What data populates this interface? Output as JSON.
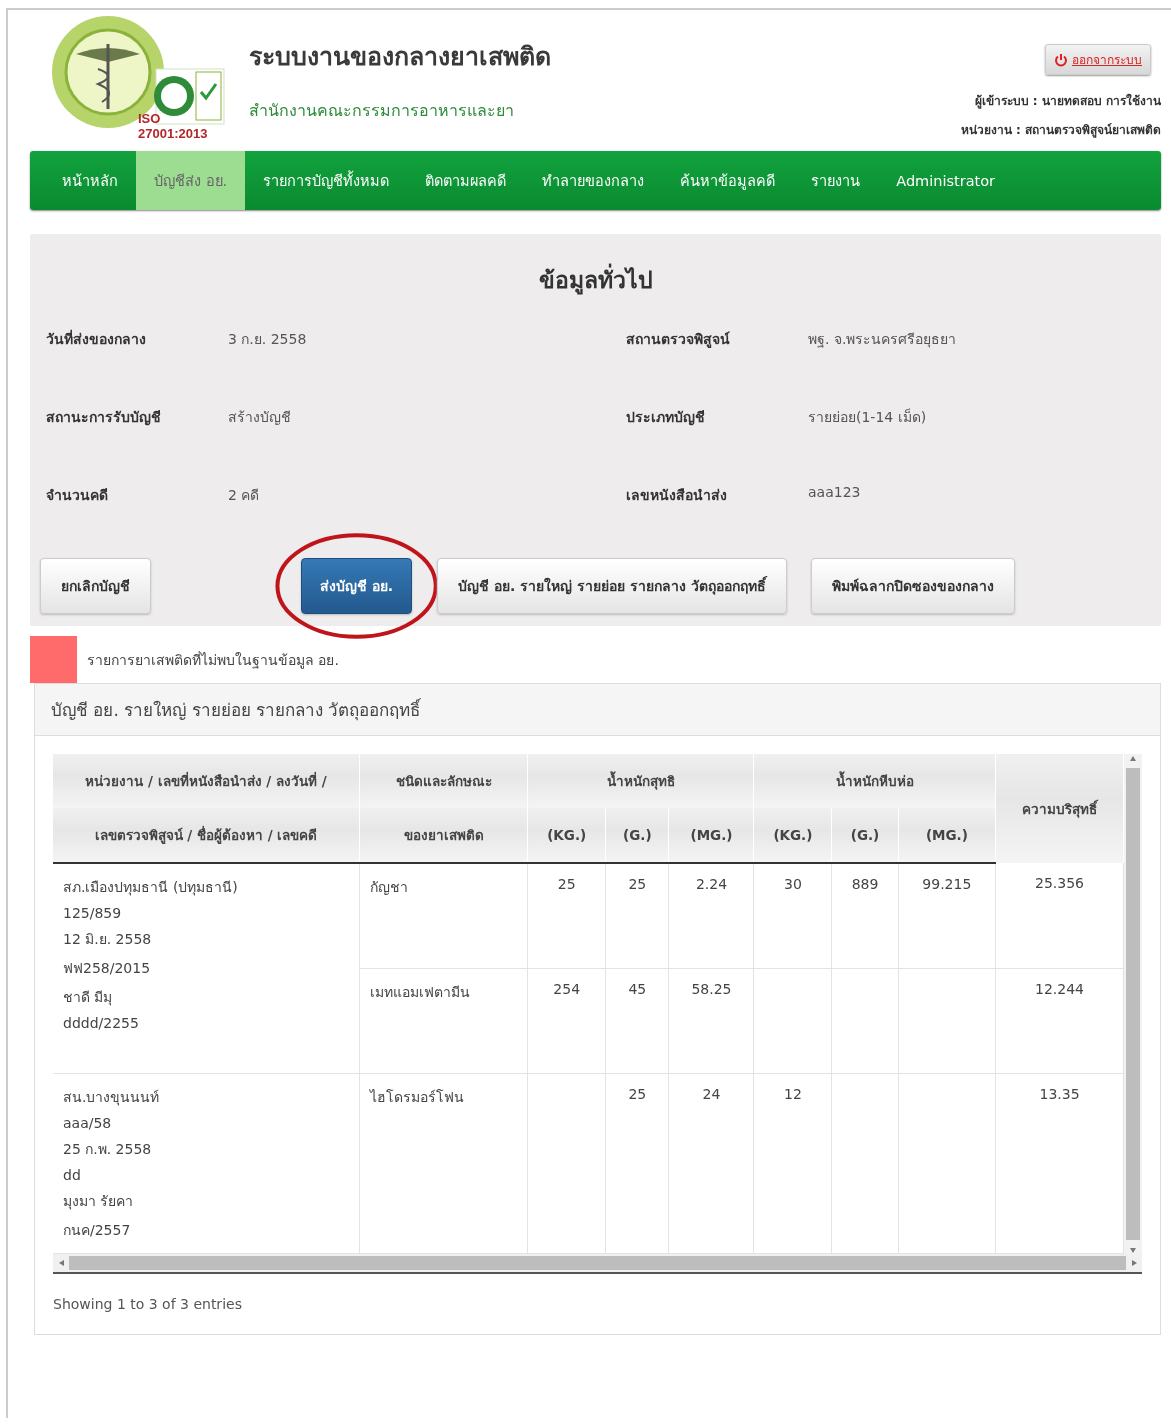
{
  "header": {
    "title": "ระบบงานของกลางยาเสพติด",
    "subtitle": "สำนักงานคณะกรรมการอาหารและยา",
    "logo_caption": "ISO 27001:2013",
    "logout": "ออกจากระบบ",
    "user_line": "ผู้เข้าระบบ : นายทดสอบ การใช้งาน",
    "unit_line": "หน่วยงาน : สถานตรวจพิสูจน์ยาเสพติด"
  },
  "nav": [
    {
      "label": "หน้าหลัก",
      "selected": false
    },
    {
      "label": "บัญชีส่ง อย.",
      "selected": true
    },
    {
      "label": "รายการบัญชีทั้งหมด",
      "selected": false
    },
    {
      "label": "ติดตามผลคดี",
      "selected": false
    },
    {
      "label": "ทำลายของกลาง",
      "selected": false
    },
    {
      "label": "ค้นหาข้อมูลคดี",
      "selected": false
    },
    {
      "label": "รายงาน",
      "selected": false
    },
    {
      "label": "Administrator",
      "selected": false
    }
  ],
  "info": {
    "title": "ข้อมูลทั่วไป",
    "fields": [
      {
        "label": "วันที่ส่งของกลาง",
        "value": "3 ก.ย. 2558"
      },
      {
        "label": "สถานตรวจพิสูจน์",
        "value": "พฐ. จ.พระนครศรีอยุธยา"
      },
      {
        "label": "สถานะการรับบัญชี",
        "value": "สร้างบัญชี"
      },
      {
        "label": "ประเภทบัญชี",
        "value": "รายย่อย(1-14 เม็ด)"
      },
      {
        "label": "จำนวนคดี",
        "value": "2 คดี"
      },
      {
        "label": "เลขหนังสือนำส่ง",
        "value": "aaa123"
      }
    ],
    "buttons": [
      {
        "label": "ยกเลิกบัญชี",
        "kind": "default",
        "circled": false
      },
      {
        "label": "ส่งบัญชี อย.",
        "kind": "primary",
        "circled": true
      },
      {
        "label": "บัญชี อย. รายใหญ่ รายย่อย รายกลาง วัตถุออกฤทธิ์",
        "kind": "default",
        "circled": false
      },
      {
        "label": "พิมพ์ฉลากปิดซองของกลาง",
        "kind": "default",
        "circled": false
      }
    ]
  },
  "legend": {
    "color": "#ff6b6b",
    "label": "รายการยาเสพติดที่ไม่พบในฐานข้อมูล อย."
  },
  "panel": {
    "title": "บัญชี อย. รายใหญ่ รายย่อย รายกลาง วัตถุออกฤทธิ์",
    "table": {
      "col1": [
        "หน่วยงาน / เลขที่หนังสือนำส่ง / ลงวันที่ /",
        "เลขตรวจพิสูจน์ / ชื่อผู้ต้องหา / เลขคดี"
      ],
      "col2": [
        "ชนิดและลักษณะ",
        "ของยาเสพติด"
      ],
      "groups": [
        {
          "label": "น้ำหนักสุทธิ",
          "units": [
            "(KG.)",
            "(G.)",
            "(MG.)"
          ]
        },
        {
          "label": "น้ำหนักหีบห่อ",
          "units": [
            "(KG.)",
            "(G.)",
            "(MG.)"
          ]
        }
      ],
      "last": "ความบริสุทธิ์",
      "cases": [
        {
          "details": [
            "สภ.เมืองปทุมธานี (ปทุมธานี)",
            "125/859",
            "12 มิ.ย. 2558",
            "ฟฟ258/2015",
            "ชาดี มีมุ",
            "dddd/2255"
          ],
          "drugs": [
            {
              "name": "กัญชา",
              "net_kg": "25",
              "net_g": "25",
              "net_mg": "2.24",
              "gross_kg": "30",
              "gross_g": "889",
              "gross_mg": "99.215",
              "purity": "25.356"
            },
            {
              "name": "เมทแอมเฟตามีน",
              "net_kg": "254",
              "net_g": "45",
              "net_mg": "58.25",
              "purity": "12.244"
            }
          ]
        },
        {
          "details": [
            "สน.บางขุนนนท์",
            "aaa/58",
            "25 ก.พ. 2558",
            "dd",
            "มุงมา รัยคา",
            "กนค/2557"
          ],
          "drugs": [
            {
              "name": "ไฮโดรมอร์โฟน",
              "net_g": "25",
              "net_mg": "24",
              "gross_kg": "12",
              "purity": "13.35"
            }
          ]
        }
      ]
    },
    "footer": "Showing 1 to 3 of 3 entries"
  }
}
